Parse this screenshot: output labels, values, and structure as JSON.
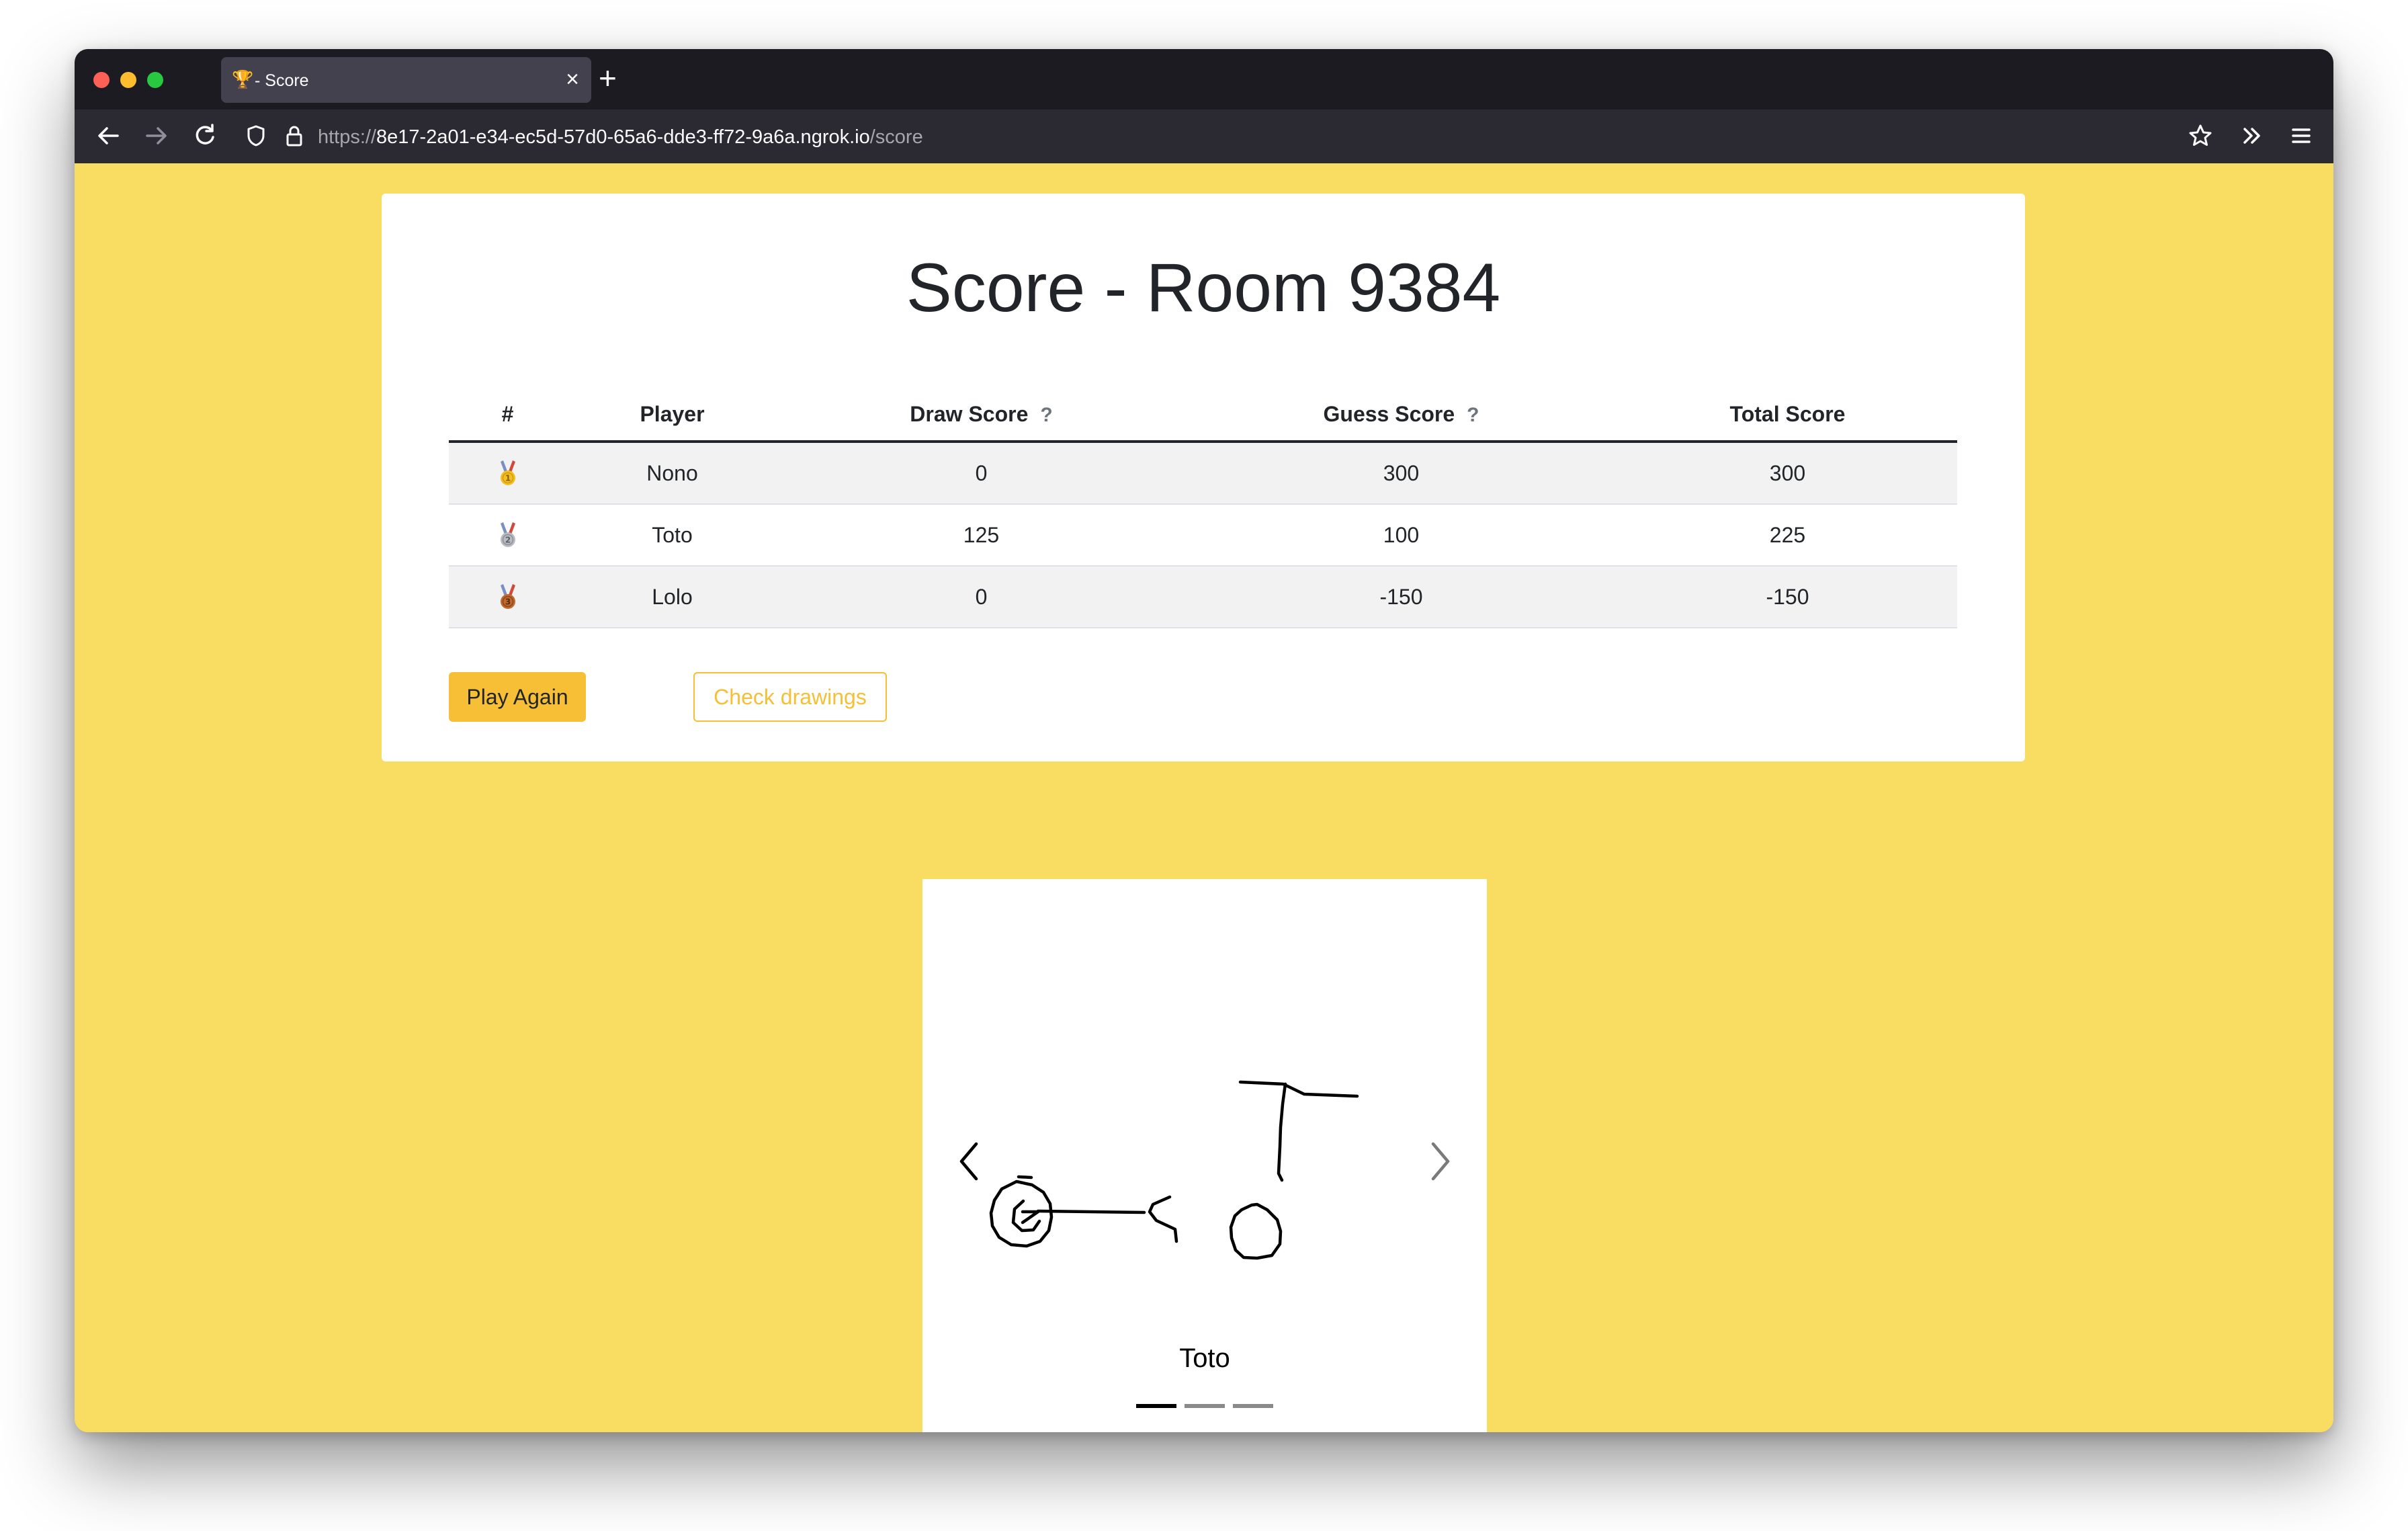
{
  "browser": {
    "tab": {
      "favicon": "🏆",
      "title": "- Score"
    },
    "new_tab_glyph": "+",
    "close_glyph": "×",
    "url": {
      "prefix": "https://",
      "host": "8e17-2a01-e34-ec5d-57d0-65a6-dde3-ff72-9a6a.ngrok.io",
      "path": "/score"
    },
    "icons": [
      "back-icon",
      "forward-icon",
      "reload-icon",
      "shield-icon",
      "lock-icon",
      "bookmark-star-icon",
      "extensions-overflow-icon",
      "menu-icon"
    ]
  },
  "page": {
    "title": "Score - Room 9384",
    "table": {
      "headers": [
        "#",
        "Player",
        "Draw Score",
        "Guess Score",
        "Total Score"
      ],
      "help_glyph": "?",
      "rows": [
        {
          "rank_icon": "gold-medal-icon",
          "rank": "1",
          "player": "Nono",
          "draw": "0",
          "guess": "300",
          "total": "300"
        },
        {
          "rank_icon": "silver-medal-icon",
          "rank": "2",
          "player": "Toto",
          "draw": "125",
          "guess": "100",
          "total": "225"
        },
        {
          "rank_icon": "bronze-medal-icon",
          "rank": "3",
          "player": "Lolo",
          "draw": "0",
          "guess": "-150",
          "total": "-150"
        }
      ]
    },
    "buttons": {
      "play_again": "Play Again",
      "check_drawings": "Check drawings"
    },
    "carousel": {
      "caption": "Toto",
      "slide_count": 3,
      "active_index": 0
    }
  },
  "colors": {
    "page_background": "#f9dc62",
    "primary": "#f6bf35",
    "browser_chrome": "#1c1b22",
    "toolbar": "#2b2a33"
  }
}
